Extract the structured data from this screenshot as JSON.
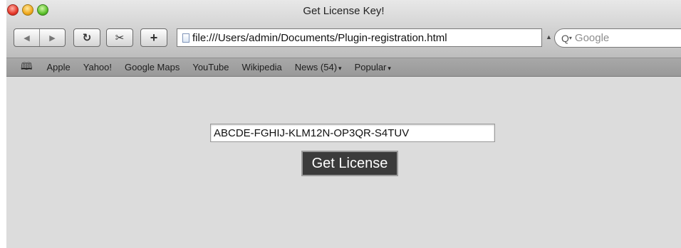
{
  "window": {
    "title": "Get License Key!"
  },
  "toolbar": {
    "back_glyph": "◀",
    "forward_glyph": "▶",
    "reload_glyph": "↻",
    "snippet_glyph": "✂",
    "add_glyph": "+",
    "url": "file:///Users/admin/Documents/Plugin-registration.html",
    "url_end_glyph": "▲",
    "search_glyph": "Q",
    "search_caret": "▾",
    "search_placeholder": "Google"
  },
  "bookmarks": {
    "book_glyph": "🕮",
    "items": [
      {
        "label": "Apple"
      },
      {
        "label": "Yahoo!"
      },
      {
        "label": "Google Maps"
      },
      {
        "label": "YouTube"
      },
      {
        "label": "Wikipedia"
      },
      {
        "label": "News (54)",
        "dropdown": "▾"
      },
      {
        "label": "Popular",
        "dropdown": "▾"
      }
    ]
  },
  "form": {
    "license_key_value": "ABCDE-FGHIJ-KLM12N-OP3QR-S4TUV",
    "button_label": "Get License"
  },
  "colors": {
    "content_bg": "#dcdcdc",
    "button_bg": "#3b3b3b",
    "button_text": "#ffffff"
  }
}
